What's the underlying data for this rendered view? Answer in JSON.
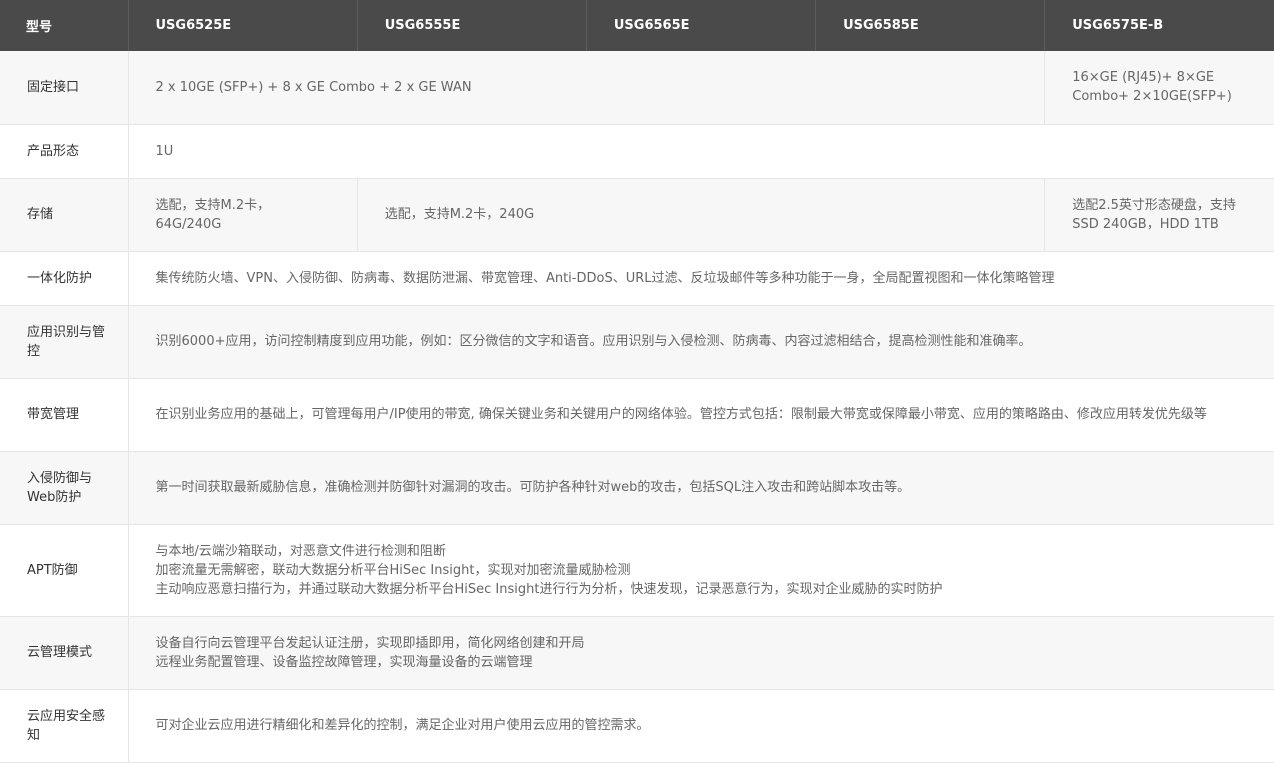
{
  "header": {
    "label": "型号",
    "models": [
      "USG6525E",
      "USG6555E",
      "USG6565E",
      "USG6585E",
      "USG6575E-B"
    ]
  },
  "rows": {
    "ports": {
      "label": "固定接口",
      "main": "2 x 10GE (SFP+) + 8 x GE Combo + 2 x GE WAN",
      "last": "16×GE (RJ45)+ 8×GE Combo+ 2×10GE(SFP+)"
    },
    "form": {
      "label": "产品形态",
      "value": "1U"
    },
    "storage": {
      "label": "存储",
      "c1": "选配，支持M.2卡，64G/240G",
      "c2": "选配，支持M.2卡，240G",
      "c5": "选配2.5英寸形态硬盘，支持SSD 240GB，HDD 1TB"
    },
    "integrated": {
      "label": "一体化防护",
      "value": "集传统防火墙、VPN、入侵防御、防病毒、数据防泄漏、带宽管理、Anti-DDoS、URL过滤、反垃圾邮件等多种功能于一身，全局配置视图和一体化策略管理"
    },
    "app_control": {
      "label": "应用识别与管控",
      "value": "识别6000+应用，访问控制精度到应用功能，例如：区分微信的文字和语音。应用识别与入侵检测、防病毒、内容过滤相结合，提高检测性能和准确率。"
    },
    "bandwidth": {
      "label": "带宽管理",
      "value": "在识别业务应用的基础上，可管理每用户/IP使用的带宽, 确保关键业务和关键用户的网络体验。管控方式包括：限制最大带宽或保障最小带宽、应用的策略路由、修改应用转发优先级等"
    },
    "ips_web": {
      "label": "入侵防御与Web防护",
      "value": "第一时间获取最新威胁信息，准确检测并防御针对漏洞的攻击。可防护各种针对web的攻击，包括SQL注入攻击和跨站脚本攻击等。"
    },
    "apt": {
      "label": "APT防御",
      "lines": [
        "与本地/云端沙箱联动，对恶意文件进行检测和阻断",
        "加密流量无需解密，联动大数据分析平台HiSec Insight，实现对加密流量威胁检测",
        "主动响应恶意扫描行为，并通过联动大数据分析平台HiSec Insight进行行为分析，快速发现，记录恶意行为，实现对企业威胁的实时防护"
      ]
    },
    "cloud_mgmt": {
      "label": "云管理模式",
      "lines": [
        "设备自行向云管理平台发起认证注册，实现即插即用，简化网络创建和开局",
        "远程业务配置管理、设备监控故障管理，实现海量设备的云端管理"
      ]
    },
    "cloud_app": {
      "label": "云应用安全感知",
      "value": "可对企业云应用进行精细化和差异化的控制，满足企业对用户使用云应用的管控需求。"
    }
  }
}
